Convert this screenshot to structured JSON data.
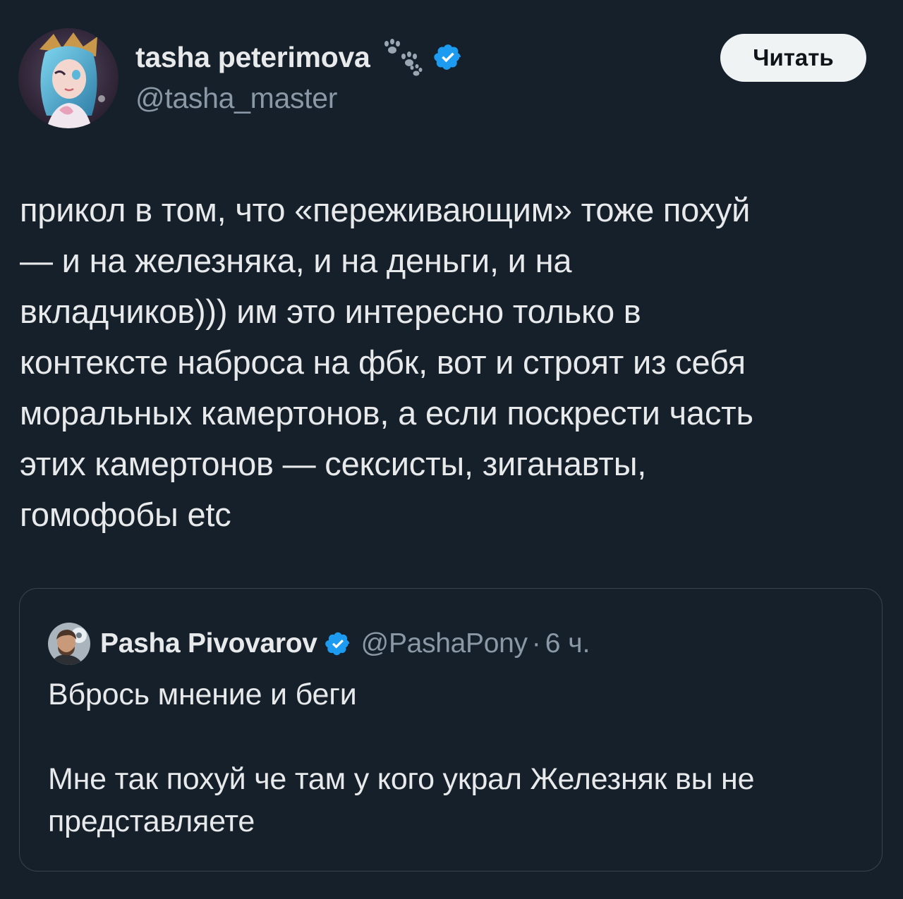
{
  "author": {
    "display_name": "tasha peterimova",
    "handle": "@tasha_master",
    "badge_emoji": "paw-prints-icon",
    "verified_color": "#1d9bf0"
  },
  "follow_button": {
    "label": "Читать"
  },
  "tweet": {
    "text": "прикол в том, что «переживающим» тоже похуй\n— и на железняка, и на деньги, и на\nвкладчиков))) им это интересно только в\nконтексте наброса на фбк, вот и строят из себя\nморальных камертонов, а если поскрести часть\nэтих камертонов — сексисты, зиганавты,\nгомофобы etc"
  },
  "quoted_tweet": {
    "display_name": "Pasha Pivovarov",
    "handle": "@PashaPony",
    "separator": "·",
    "time": "6 ч.",
    "text": "Вбрось мнение и беги\n\nМне так похуй че там у кого украл Железняк вы не\nпредставляете"
  },
  "colors": {
    "background": "#15202b",
    "text_primary": "#e7e9ea",
    "text_secondary": "#8b98a5",
    "border": "#38444d",
    "button_bg": "#eff3f4",
    "button_text": "#0f1419",
    "verified": "#1d9bf0"
  }
}
